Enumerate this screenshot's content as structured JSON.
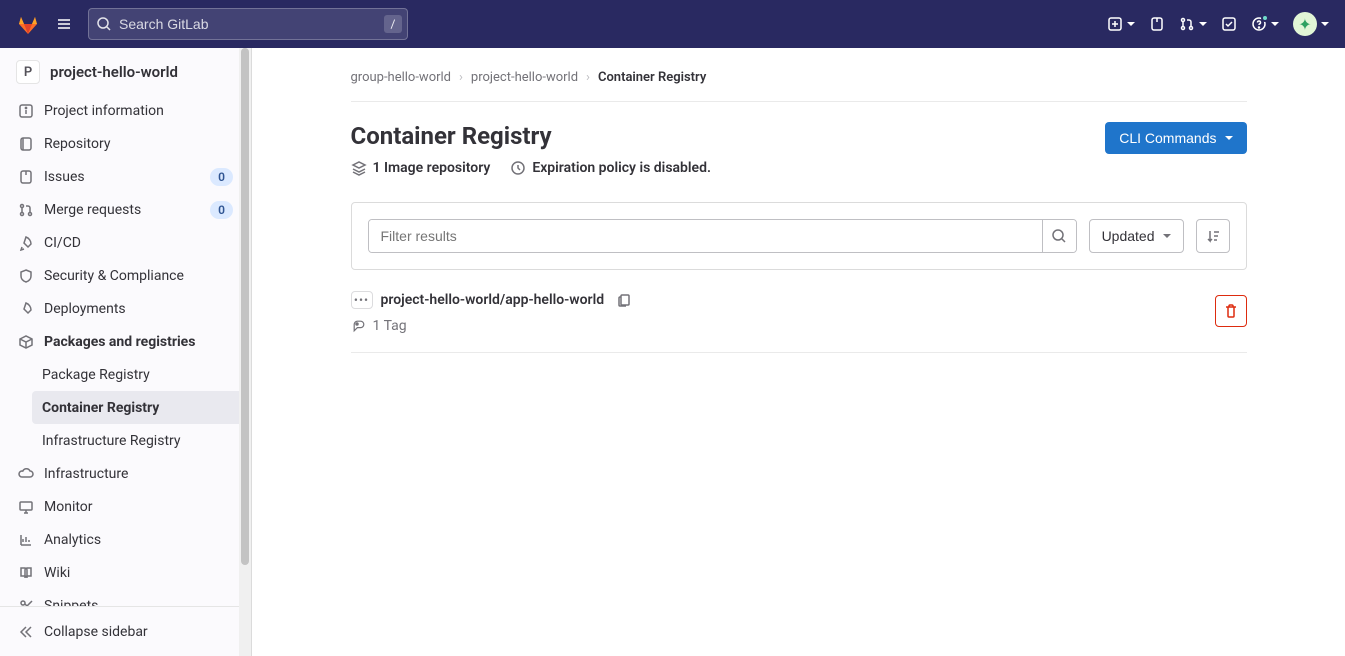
{
  "header": {
    "search_placeholder": "Search GitLab",
    "shortcut_key": "/"
  },
  "sidebar": {
    "project_initial": "P",
    "project_name": "project-hello-world",
    "items": [
      {
        "label": "Project information"
      },
      {
        "label": "Repository"
      },
      {
        "label": "Issues",
        "badge": "0"
      },
      {
        "label": "Merge requests",
        "badge": "0"
      },
      {
        "label": "CI/CD"
      },
      {
        "label": "Security & Compliance"
      },
      {
        "label": "Deployments"
      },
      {
        "label": "Packages and registries",
        "active": true
      },
      {
        "label": "Infrastructure"
      },
      {
        "label": "Monitor"
      },
      {
        "label": "Analytics"
      },
      {
        "label": "Wiki"
      },
      {
        "label": "Snippets"
      }
    ],
    "subitems": [
      {
        "label": "Package Registry"
      },
      {
        "label": "Container Registry",
        "active": true
      },
      {
        "label": "Infrastructure Registry"
      }
    ],
    "collapse_label": "Collapse sidebar"
  },
  "breadcrumbs": {
    "items": [
      "group-hello-world",
      "project-hello-world",
      "Container Registry"
    ]
  },
  "page": {
    "title": "Container Registry",
    "repo_count_text": "1 Image repository",
    "expiration_text": "Expiration policy is disabled.",
    "cli_button": "CLI Commands",
    "filter_placeholder": "Filter results",
    "sort_label": "Updated"
  },
  "repo": {
    "name": "project-hello-world/app-hello-world",
    "tag_text": "1 Tag"
  }
}
